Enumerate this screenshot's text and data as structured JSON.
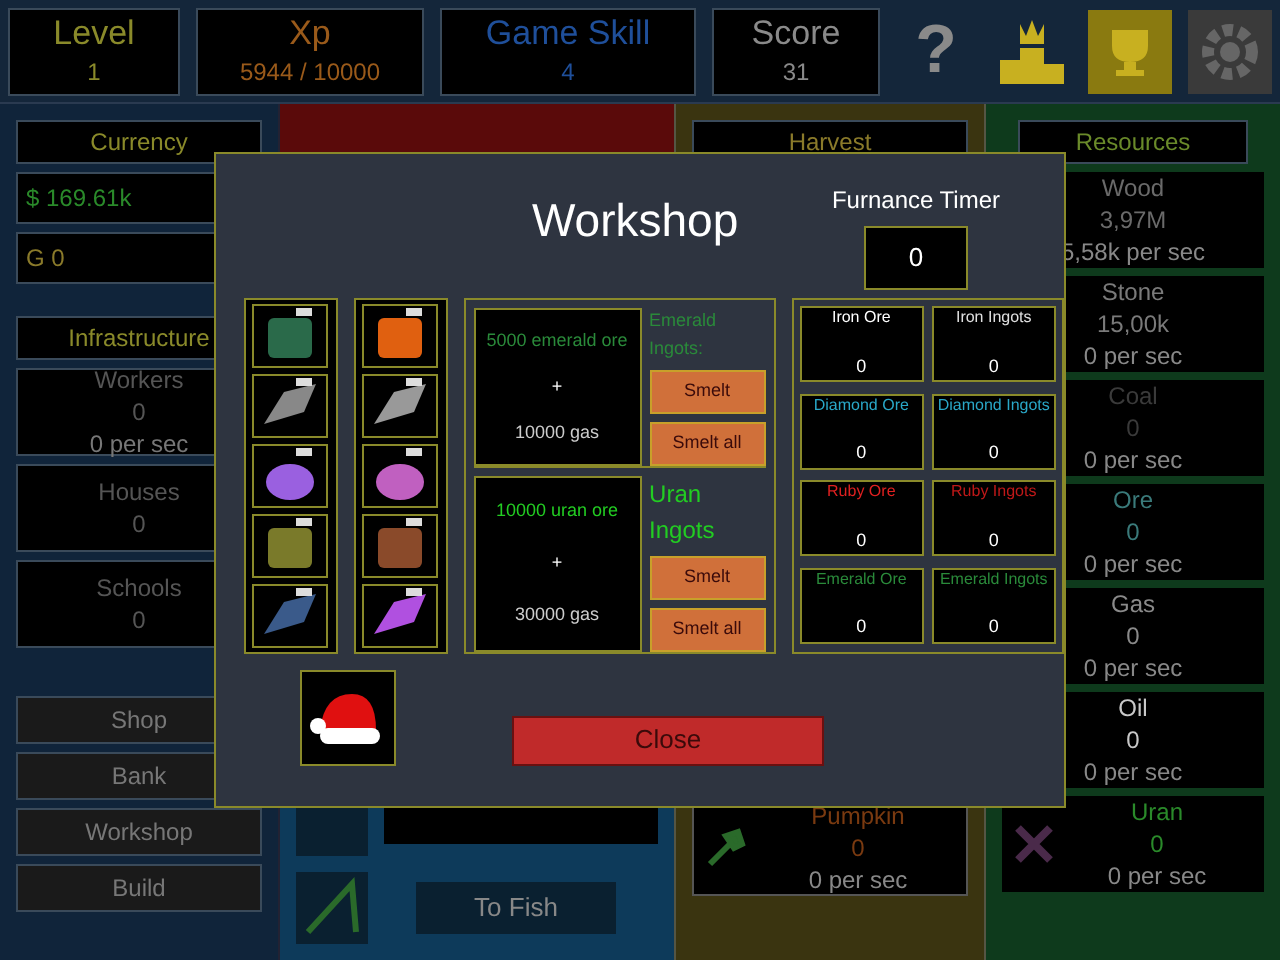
{
  "top_bar": {
    "stats": [
      {
        "label": "Level",
        "value": "1",
        "color": "#8a8a2a"
      },
      {
        "label": "Xp",
        "value": "5944 / 10000",
        "color": "#9a5a1a"
      },
      {
        "label": "Game Skill",
        "value": "4",
        "color": "#1f4f9a"
      },
      {
        "label": "Score",
        "value": "31",
        "color": "#8a8a8a"
      }
    ],
    "help": "?"
  },
  "currency": {
    "title": "Currency",
    "money": "$ 169.61k",
    "gold": "G 0"
  },
  "infrastructure": {
    "title": "Infrastructure",
    "items": [
      {
        "name": "Workers",
        "value": "0",
        "rate": "0 per sec"
      },
      {
        "name": "Houses",
        "value": "0"
      },
      {
        "name": "Schools",
        "value": "0"
      }
    ]
  },
  "nav": [
    "Shop",
    "Bank",
    "Workshop",
    "Build"
  ],
  "fishing": {
    "button": "To Fish"
  },
  "harvest": {
    "title": "Harvest",
    "crop": {
      "name": "Pumpkin",
      "value": "0",
      "rate": "0 per sec"
    }
  },
  "resources": {
    "title": "Resources",
    "items": [
      {
        "name": "Wood",
        "value": "3,97M",
        "rate": "5,58k per sec",
        "color": "#6a6a6a"
      },
      {
        "name": "Stone",
        "value": "15,00k",
        "rate": "0 per sec",
        "color": "#7a7a7a"
      },
      {
        "name": "Coal",
        "value": "0",
        "rate": "0 per sec",
        "color": "#3a3a3a"
      },
      {
        "name": "Ore",
        "value": "0",
        "rate": "0 per sec",
        "color": "#3a7a7a"
      },
      {
        "name": "Gas",
        "value": "0",
        "rate": "0 per sec",
        "color": "#8a8a8a"
      },
      {
        "name": "Oil",
        "value": "0",
        "rate": "0 per sec",
        "color": "#c8c8c8"
      },
      {
        "name": "Uran",
        "value": "0",
        "rate": "0 per sec",
        "color": "#2a8a2a"
      }
    ]
  },
  "workshop": {
    "title": "Workshop",
    "timer_label": "Furnance Timer",
    "timer_value": "0",
    "recipes": [
      {
        "ore": "5000 emerald ore",
        "plus": "+",
        "gas": "10000 gas",
        "output": "Emerald Ingots:",
        "color": "#2a8a3a",
        "buttons": [
          "Smelt",
          "Smelt all"
        ]
      },
      {
        "ore": "10000 uran ore",
        "plus": "+",
        "gas": "30000 gas",
        "output": "Uran Ingots",
        "color": "#22cc22",
        "buttons": [
          "Smelt",
          "Smelt all"
        ]
      }
    ],
    "inventory": [
      {
        "name": "Iron Ore",
        "value": "0",
        "color": "#ffffff"
      },
      {
        "name": "Iron Ingots",
        "value": "0",
        "color": "#e0e0e0"
      },
      {
        "name": "Diamond Ore",
        "value": "0",
        "color": "#2aa8c8"
      },
      {
        "name": "Diamond Ingots",
        "value": "0",
        "color": "#2aa8c8"
      },
      {
        "name": "Ruby Ore",
        "value": "0",
        "color": "#e02020"
      },
      {
        "name": "Ruby Ingots",
        "value": "0",
        "color": "#c01818"
      },
      {
        "name": "Emerald Ore",
        "value": "0",
        "color": "#2a8a3a"
      },
      {
        "name": "Emerald Ingots",
        "value": "0",
        "color": "#2a8a3a"
      }
    ],
    "close": "Close"
  }
}
